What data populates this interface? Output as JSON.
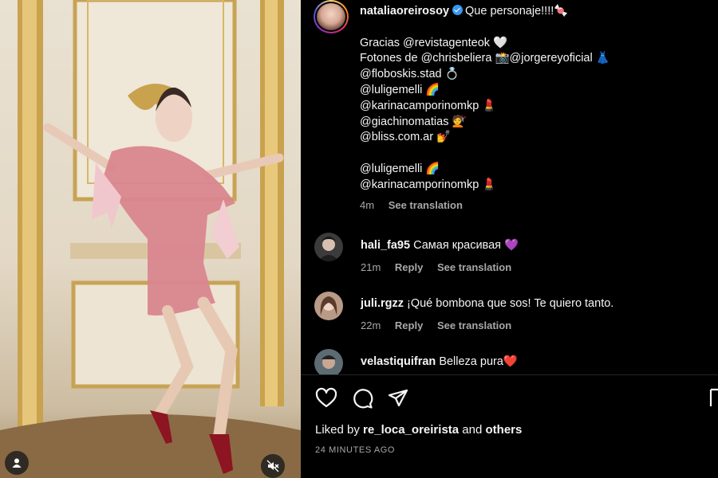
{
  "post": {
    "owner": "nataliaoreirosoy",
    "caption_first": "Que personaje!!!!🍬",
    "caption_lines": [
      "Gracias @revistagenteok 🤍",
      "Fotones de @chrisbeliera 📸@jorgereyoficial 👗",
      "@floboskis.stad 💍",
      "@luligemelli 🌈",
      "@karinacamporinomkp 💄",
      "@giachinomatias 💇",
      "@bliss.com.ar 💅",
      "",
      "@luligemelli 🌈",
      "@karinacamporinomkp 💄"
    ],
    "caption_time": "4m",
    "see_translation": "See translation"
  },
  "comments": [
    {
      "user": "hali_fa95",
      "text": "Самая красивая 💜",
      "time": "21m",
      "reply": "Reply",
      "translate": "See translation"
    },
    {
      "user": "juli.rgzz",
      "text": "¡Qué bombona que sos! Te quiero tanto.",
      "time": "22m",
      "reply": "Reply",
      "translate": "See translation"
    },
    {
      "user": "velastiquifran",
      "text": "Belleza pura❤️"
    }
  ],
  "footer": {
    "liked_prefix": "Liked by",
    "liked_user": "re_loca_oreirista",
    "liked_and": "and",
    "liked_others": "others",
    "timestamp": "24 MINUTES AGO"
  },
  "icons": {
    "like": "heart-icon",
    "comment": "comment-icon",
    "share": "share-icon",
    "save": "bookmark-icon",
    "profile": "user-icon",
    "mute": "muted-speaker-icon"
  },
  "colors": {
    "verified": "#3897f0",
    "muted_text": "#a8a8a8",
    "background": "#000000"
  }
}
